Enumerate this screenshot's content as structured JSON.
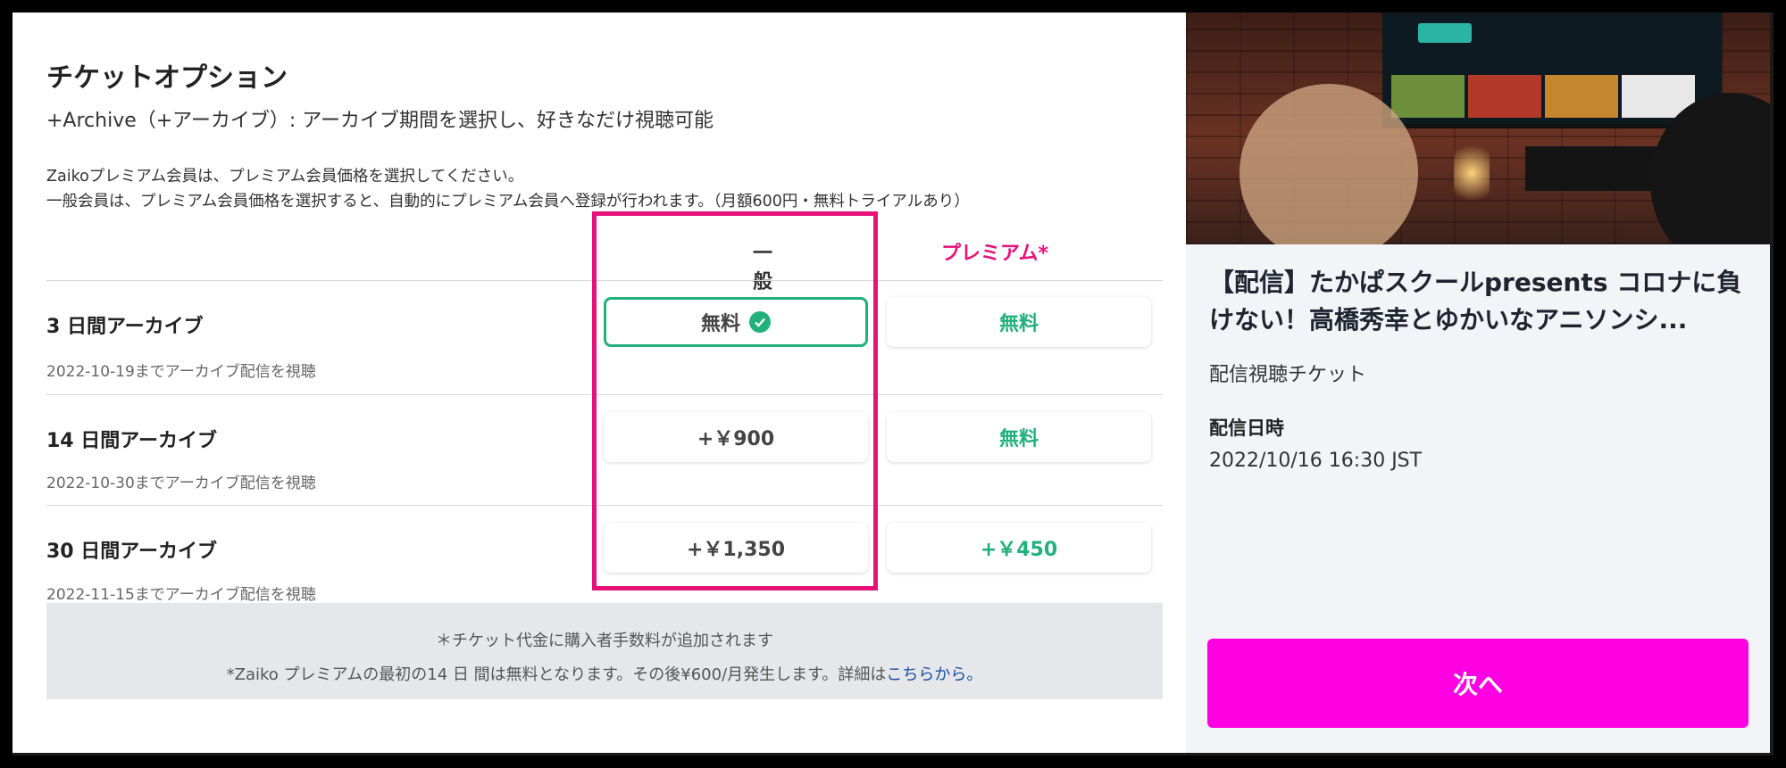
{
  "header": {
    "title": "チケットオプション",
    "subtitle": "+Archive（+アーカイブ）: アーカイブ期間を選択し、好きなだけ視聴可能"
  },
  "notes": [
    "Zaikoプレミアム会員は、プレミアム会員価格を選択してください。",
    "一般会員は、プレミアム会員価格を選択すると、自動的にプレミアム会員へ登録が行われます。（月額600円・無料トライアルあり）"
  ],
  "columns": {
    "general": "一般",
    "premium": "プレミアム*"
  },
  "options": [
    {
      "title": "3 日間アーカイブ",
      "subtitle": "2022-10-19までアーカイブ配信を視聴",
      "general_price": "無料",
      "premium_price": "無料",
      "selected": true
    },
    {
      "title": "14 日間アーカイブ",
      "subtitle": "2022-10-30までアーカイブ配信を視聴",
      "general_price": "+￥900",
      "premium_price": "無料",
      "selected": false
    },
    {
      "title": "30 日間アーカイブ",
      "subtitle": "2022-11-15までアーカイブ配信を視聴",
      "general_price": "+￥1,350",
      "premium_price": "+￥450",
      "selected": false
    }
  ],
  "fees": {
    "line1": "＊チケット代金に購入者手数料が追加されます",
    "line2_text": "*Zaiko プレミアムの最初の14 日 間は無料となります。その後¥600/月発生します。詳細は",
    "line2_link": "こちらから。"
  },
  "event": {
    "title": "【配信】たかぱスクールpresents コロナに負けない！高橋秀幸とゆかいなアニソンシ...",
    "ticket_type": "配信視聴チケット",
    "date_label": "配信日時",
    "date_value": "2022/10/16 16:30 JST"
  },
  "next_button": "次へ",
  "colors": {
    "accent_green": "#22b07d",
    "premium_pink": "#e6127a",
    "button_magenta": "#ff00e2",
    "highlight_border": "#e6127a"
  }
}
